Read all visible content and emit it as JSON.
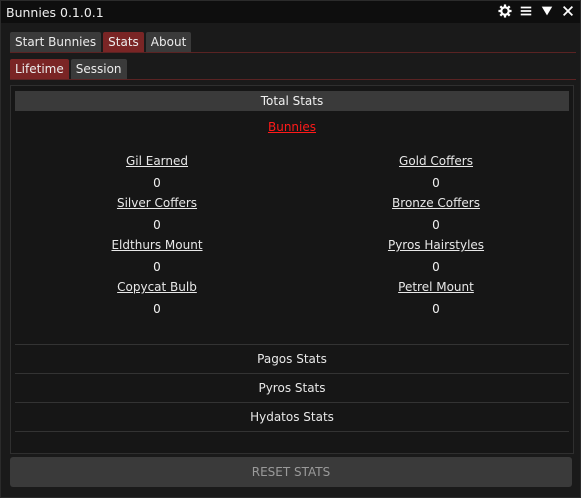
{
  "window": {
    "title": "Bunnies 0.1.0.1",
    "icons": [
      "gear-icon",
      "menu-icon",
      "collapse-icon",
      "close-icon"
    ]
  },
  "main_tabs": [
    {
      "label": "Start Bunnies",
      "active": false
    },
    {
      "label": "Stats",
      "active": true
    },
    {
      "label": "About",
      "active": false
    }
  ],
  "sub_tabs": [
    {
      "label": "Lifetime",
      "active": true
    },
    {
      "label": "Session",
      "active": false
    }
  ],
  "panel": {
    "header": "Total Stats",
    "section_title": "Bunnies",
    "stats": [
      {
        "label": "Gil Earned",
        "value": "0"
      },
      {
        "label": "Gold Coffers",
        "value": "0"
      },
      {
        "label": "Silver Coffers",
        "value": "0"
      },
      {
        "label": "Bronze Coffers",
        "value": "0"
      },
      {
        "label": "Eldthurs Mount",
        "value": "0"
      },
      {
        "label": "Pyros Hairstyles",
        "value": "0"
      },
      {
        "label": "Copycat Bulb",
        "value": "0"
      },
      {
        "label": "Petrel Mount",
        "value": "0"
      }
    ],
    "collapsibles": [
      "Pagos Stats",
      "Pyros Stats",
      "Hydatos Stats"
    ]
  },
  "reset_button": "RESET STATS",
  "colors": {
    "accent": "#7a2525",
    "section_title": "#ff1a1a",
    "background": "#1a1a1a"
  }
}
